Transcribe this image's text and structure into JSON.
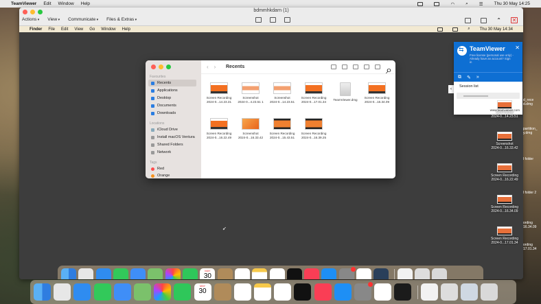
{
  "host_menubar": {
    "app": "TeamViewer",
    "items": [
      "Edit",
      "Window",
      "Help"
    ],
    "clock": "Thu 30 May 14:25"
  },
  "tv_window": {
    "title": "bdmmhkdarn (1)",
    "toolbar": [
      "Actions",
      "View",
      "Communicate",
      "Files & Extras"
    ]
  },
  "remote_menubar": {
    "app": "Finder",
    "items": [
      "File",
      "Edit",
      "View",
      "Go",
      "Window",
      "Help"
    ],
    "clock": "Thu 30 May 14:34"
  },
  "finder": {
    "title": "Recents",
    "sections": {
      "favourites": "Favourites",
      "locations": "Locations",
      "tags": "Tags"
    },
    "favourites": [
      "Recents",
      "Applications",
      "Desktop",
      "Documents",
      "Downloads"
    ],
    "locations": [
      "iCloud Drive",
      "Install macOS Ventura",
      "Shared Folders",
      "Network"
    ],
    "tags": [
      "Red",
      "Orange"
    ],
    "files": [
      {
        "name": "Screen Recording",
        "sub": "2024-0...14.23.31",
        "kind": "rec"
      },
      {
        "name": "Screenshot",
        "sub": "2024-0...4.23.51 1",
        "kind": "ss"
      },
      {
        "name": "Screenshot",
        "sub": "2024-0...14.23.51",
        "kind": "ss"
      },
      {
        "name": "Screen Recording",
        "sub": "2024-0...17.01.34",
        "kind": "rec"
      },
      {
        "name": "TeamViewer.dmg",
        "sub": "",
        "kind": "dmg"
      },
      {
        "name": "Screen Recording",
        "sub": "2024-0...16.34.09",
        "kind": "rec"
      },
      {
        "name": "Screen Recording",
        "sub": "2024-0...16.22.49",
        "kind": "rec"
      },
      {
        "name": "Screenshot",
        "sub": "2024-0...16.33.42",
        "kind": "or"
      },
      {
        "name": "Screen Recording",
        "sub": "2024-0...15.43.51",
        "kind": "dk"
      },
      {
        "name": "Screen Recording",
        "sub": "2024-0...16.39.25",
        "kind": "dk"
      }
    ]
  },
  "tv_panel": {
    "brand": "TeamViewer",
    "message": "Free license (personal use only) - Already have an account? Sign in",
    "session_label": "Session list",
    "footer": "www.teamviewer.com"
  },
  "remote_desktop": [
    {
      "name": "Screenshot",
      "sub": "2024-0...14.23.51"
    },
    {
      "name": "Screenshot",
      "sub": "2024-0...16.33.42"
    },
    {
      "name": "Screen Recording",
      "sub": "2024-0...16.22.49"
    },
    {
      "name": "Screen Recording",
      "sub": "2024-0...16.34.09"
    },
    {
      "name": "Screen Recording",
      "sub": "2024-0...17.01.34"
    }
  ],
  "host_desktop_cut": [
    "d_rece",
    "d.dmg",
    "partition_",
    "y.dmg",
    "l folder",
    "l folder 2",
    "ording",
    "16.34.09",
    "ording",
    "17.01.34"
  ],
  "dock_remote_icons": [
    "finder-icon",
    "launchpad-icon",
    "safari-icon",
    "messages-icon",
    "mail-icon",
    "maps-icon",
    "photos-icon",
    "facetime-icon",
    "calendar-icon",
    "contacts-icon",
    "reminders-icon",
    "notes-icon",
    "freeform-icon",
    "tv-icon",
    "music-icon",
    "appstore-icon",
    "settings-icon",
    "teamviewer-icon",
    "quicktime-icon",
    "document-icon",
    "screenshot-icon",
    "trash-icon"
  ],
  "dock_host_icons": [
    "finder-icon",
    "launchpad-icon",
    "safari-icon",
    "messages-icon",
    "mail-icon",
    "maps-icon",
    "photos-icon",
    "facetime-icon",
    "calendar-icon",
    "contacts-icon",
    "reminders-icon",
    "notes-icon",
    "freeform-icon",
    "tv-icon",
    "music-icon",
    "appstore-icon",
    "settings-icon",
    "teamviewer-icon",
    "activity-monitor-icon",
    "document-icon",
    "screenshot-icon",
    "preview-icon",
    "trash-icon"
  ],
  "calendar": {
    "month": "MAY",
    "day": "30"
  },
  "colors": {
    "teamviewer_blue": "#0e6fd3",
    "finder_selection": "#d2ccc9",
    "tag_red": "#ff4c4c",
    "tag_orange": "#f7931e"
  }
}
